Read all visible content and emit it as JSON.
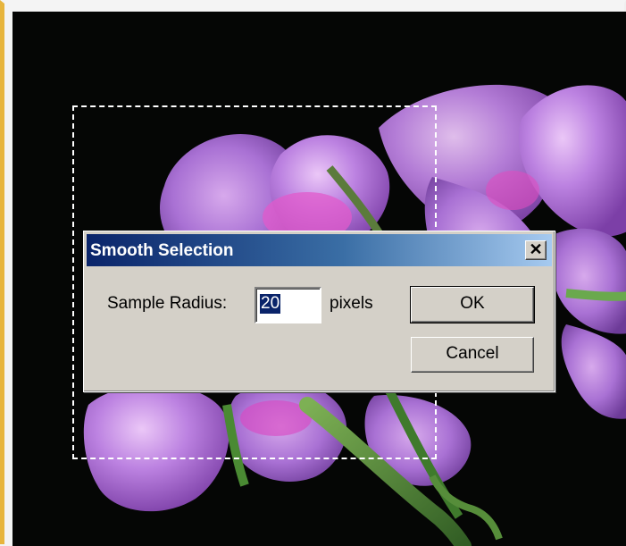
{
  "dialog": {
    "title": "Smooth Selection",
    "close_glyph": "✕",
    "radius_label": "Sample Radius:",
    "radius_value": "20",
    "units_label": "pixels",
    "ok_label": "OK",
    "cancel_label": "Cancel"
  },
  "canvas": {
    "image_subject": "purple geranium flowers on black background",
    "selection": "rectangular marquee selection"
  },
  "colors": {
    "dialog_face": "#d4d0c8",
    "title_start": "#0a246a",
    "title_end": "#a6caf0",
    "window_accent": "#e7b53d"
  }
}
